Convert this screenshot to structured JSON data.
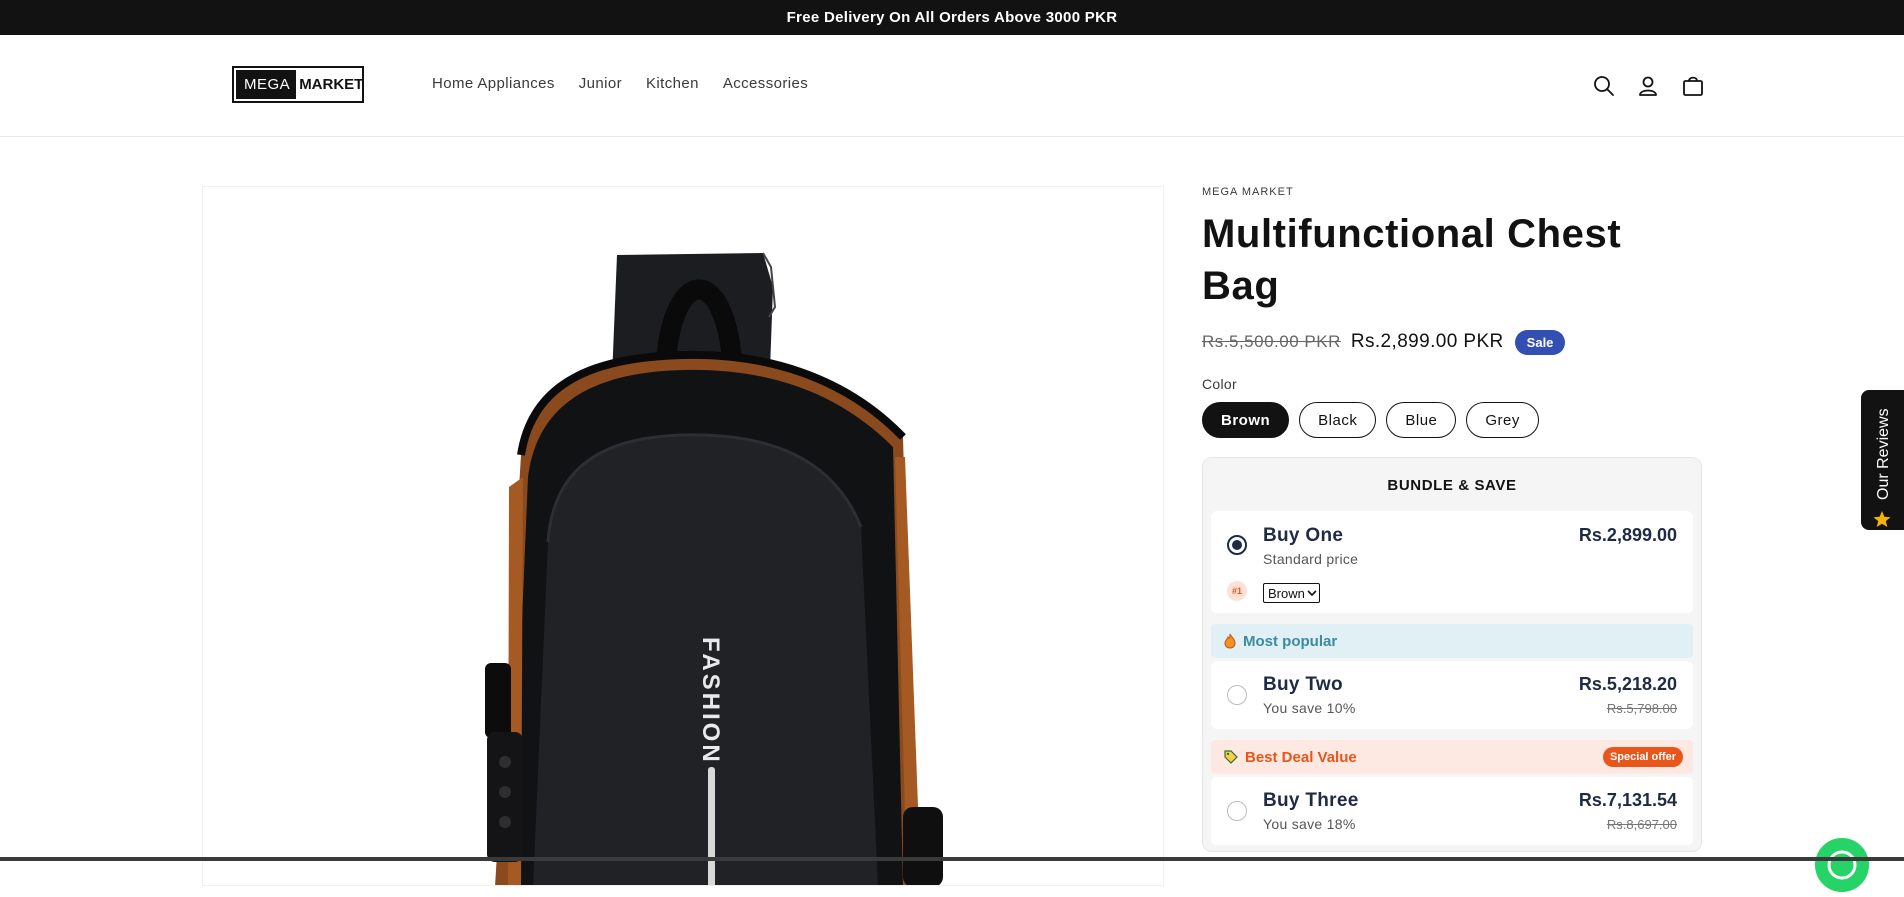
{
  "announcement": "Free Delivery On All Orders Above 3000 PKR",
  "logo": {
    "part1": "MEGA",
    "part2": "MARKET"
  },
  "nav": [
    "Home Appliances",
    "Junior",
    "Kitchen",
    "Accessories"
  ],
  "header_icons": [
    "search-icon",
    "account-icon",
    "cart-icon"
  ],
  "product": {
    "vendor": "MEGA MARKET",
    "title_line1": "Multifunctional Chest",
    "title_line2": "Bag",
    "compare_price": "Rs.5,500.00 PKR",
    "price": "Rs.2,899.00 PKR",
    "sale_badge": "Sale",
    "image_text": "FASHION",
    "color_label": "Color",
    "colors": [
      "Brown",
      "Black",
      "Blue",
      "Grey"
    ],
    "selected_color": "Brown"
  },
  "bundle": {
    "title": "BUNDLE & SAVE",
    "options": [
      {
        "name": "Buy One",
        "sub": "Standard price",
        "price": "Rs.2,899.00",
        "compare": "",
        "selected": true,
        "item_tag": "#1",
        "variant": "Brown"
      },
      {
        "strip": "Most popular",
        "name": "Buy Two",
        "sub": "You save 10%",
        "price": "Rs.5,218.20",
        "compare": "Rs.5,798.00",
        "selected": false
      },
      {
        "strip": "Best Deal Value",
        "strip_badge": "Special offer",
        "name": "Buy Three",
        "sub": "You save 18%",
        "price": "Rs.7,131.54",
        "compare": "Rs.8,697.00",
        "selected": false
      }
    ]
  },
  "reviews_tab": "Our Reviews",
  "colors": {
    "sale_badge": "#334fb4",
    "most_popular_bg": "#e0f0f4",
    "best_deal_bg": "#fde9e1",
    "accent_orange": "#e8561b"
  }
}
